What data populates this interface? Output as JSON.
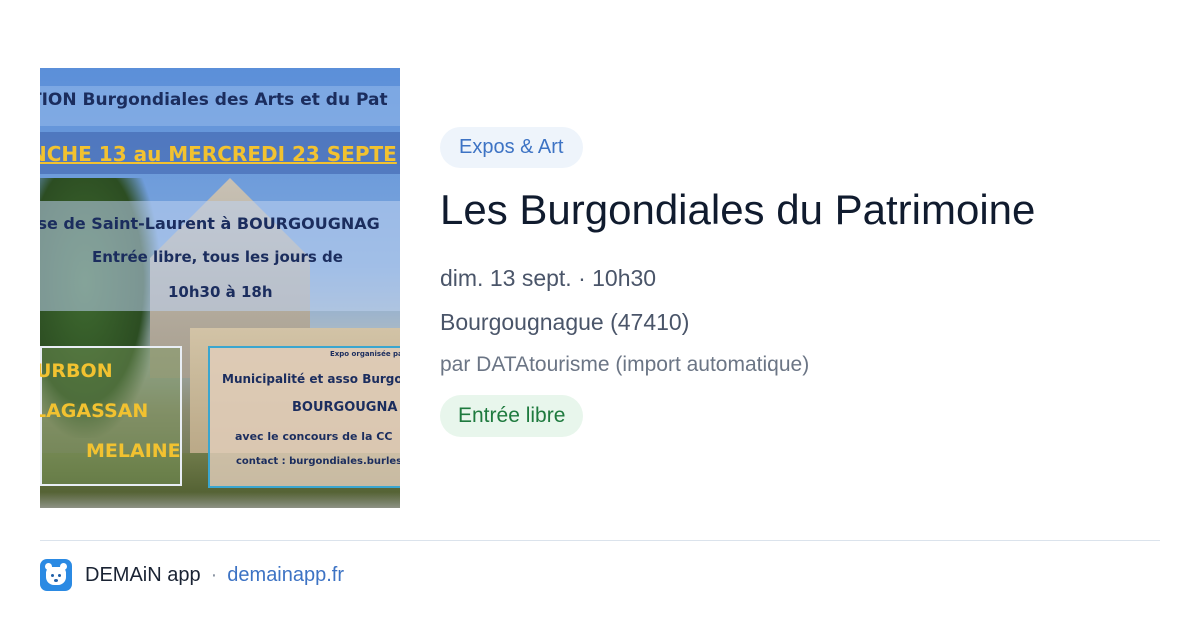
{
  "event_image": {
    "poster_lines": {
      "line1": "TION Burgondiales des Arts et du Pat",
      "line2": "NCHE 13 au MERCREDI 23 SEPTE",
      "line3": "ise de Saint-Laurent à BOURGOUGNAG",
      "line4": "Entrée libre, tous les jours de",
      "line5": "10h30 à 18h",
      "line6": "URBON",
      "line7": "LAGASSAN",
      "line8": "MELAINE",
      "line9": "Expo organisée par",
      "line10": "Municipalité et asso Burgon",
      "line11": "BOURGOUGNA",
      "line12": "avec le concours de la CC",
      "line13": "contact : burgondiales.burlesq"
    }
  },
  "event": {
    "category": "Expos & Art",
    "title": "Les Burgondiales du Patrimoine",
    "date_time": "dim. 13 sept. · 10h30",
    "location": "Bourgougnague (47410)",
    "organizer": "par DATAtourisme (import automatique)",
    "price": "Entrée libre"
  },
  "footer": {
    "app_name": "DEMAiN app",
    "separator": "·",
    "site": "demainapp.fr"
  },
  "colors": {
    "accent_blue": "#3d73c4",
    "badge_bg": "#eef4fb",
    "price_green": "#1e7a3e",
    "price_bg": "#e8f6ec"
  }
}
